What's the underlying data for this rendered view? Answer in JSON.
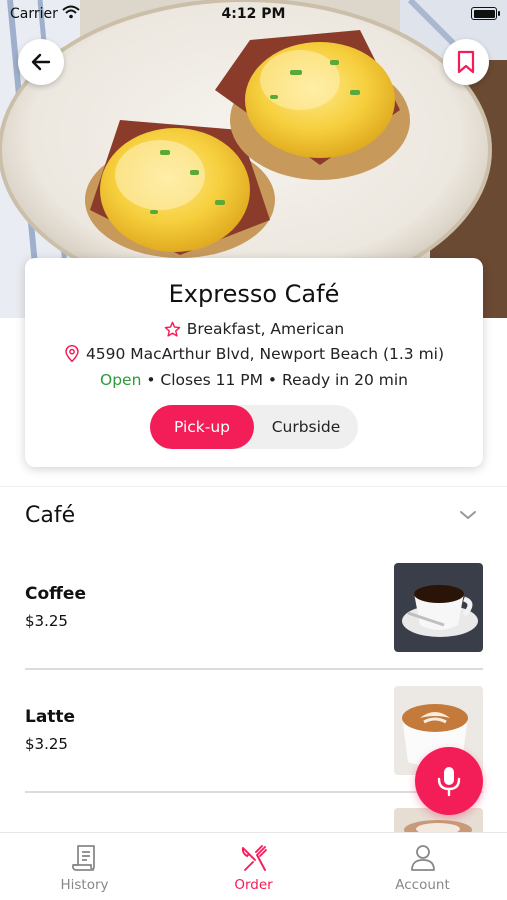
{
  "status_bar": {
    "carrier": "Carrier",
    "time": "4:12 PM"
  },
  "header": {
    "back_icon": "arrow-left-icon",
    "bookmark_icon": "bookmark-icon"
  },
  "restaurant": {
    "name": "Expresso Café",
    "cuisine": "Breakfast, American",
    "address": "4590 MacArthur Blvd, Newport Beach (1.3 mi)",
    "status_open": "Open",
    "hours_info": " • Closes 11 PM • Ready in 20 min"
  },
  "order_type": {
    "options": [
      "Pick-up",
      "Curbside"
    ],
    "selected": "Pick-up"
  },
  "menu": {
    "section_title": "Café",
    "items": [
      {
        "name": "Coffee",
        "price": "$3.25"
      },
      {
        "name": "Latte",
        "price": "$3.25"
      }
    ]
  },
  "tab_bar": {
    "tabs": [
      {
        "label": "History",
        "icon": "receipt-icon"
      },
      {
        "label": "Order",
        "icon": "utensils-icon"
      },
      {
        "label": "Account",
        "icon": "person-icon"
      }
    ],
    "active": "Order"
  },
  "colors": {
    "accent": "#f31d57",
    "open_green": "#2e9a3c"
  }
}
